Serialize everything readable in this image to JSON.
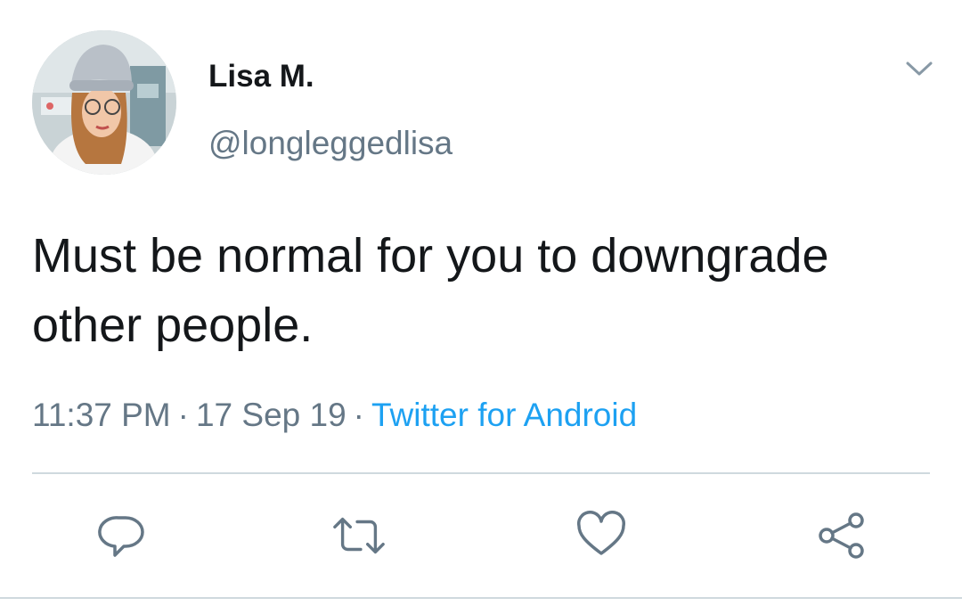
{
  "tweet": {
    "display_name": "Lisa M.",
    "handle": "@longleggedlisa",
    "text": "Must be normal for you to downgrade other people.",
    "time": "11:37 PM",
    "date": "17 Sep 19",
    "separator": "·",
    "source": "Twitter for Android"
  },
  "icons": {
    "menu": "chevron-down-icon",
    "reply": "reply-icon",
    "retweet": "retweet-icon",
    "like": "heart-icon",
    "share": "share-icon"
  },
  "colors": {
    "text": "#14171a",
    "secondary": "#657786",
    "link": "#1da1f2",
    "divider": "#cfd9de"
  }
}
